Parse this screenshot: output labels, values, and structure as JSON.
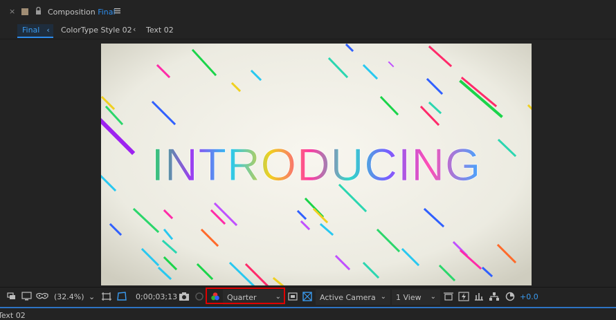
{
  "panel": {
    "title_prefix": "Composition",
    "title_name": "Final"
  },
  "breadcrumbs": [
    {
      "label": "Final"
    },
    {
      "label": "ColorType Style 02"
    },
    {
      "label": "Text 02"
    }
  ],
  "preview": {
    "headline": "INTRODUCING"
  },
  "toolbar": {
    "magnification": "(32.4%)",
    "timecode": "0;00;03;13",
    "resolution": "Quarter",
    "camera": "Active Camera",
    "views": "1 View",
    "exposure": "+0.0"
  },
  "bottom": {
    "layer_name": "Text 02"
  },
  "colors": {
    "accent": "#2d8ceb",
    "highlight_box": "#e00000"
  }
}
